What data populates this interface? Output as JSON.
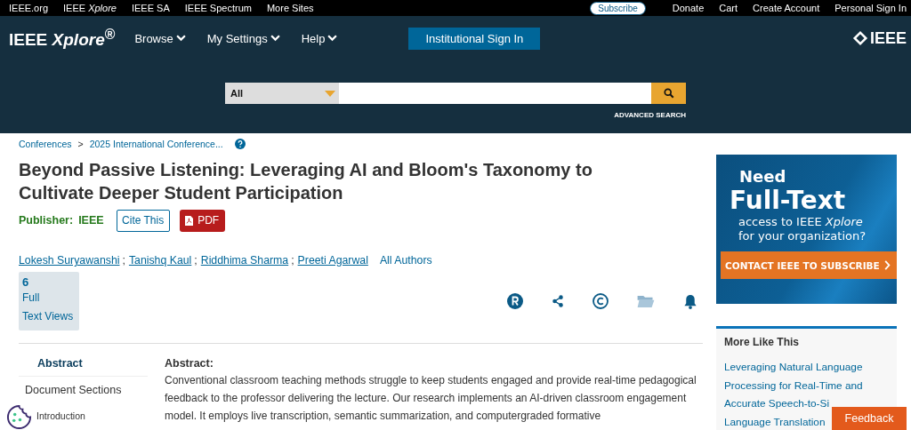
{
  "top_bar": {
    "links": [
      "IEEE.org",
      "IEEE *Xplore*",
      "IEEE SA",
      "IEEE Spectrum",
      "More Sites"
    ],
    "subscribe": "Subscribe",
    "right_links": [
      "Donate",
      "Cart",
      "Create Account",
      "Personal Sign In"
    ]
  },
  "header": {
    "logo": "IEEE *Xplore*$^{®}$",
    "menus": [
      "Browse",
      "My Settings",
      "Help"
    ],
    "sign_in": "Institutional Sign In",
    "brand": "IEEE"
  },
  "search": {
    "scope": "All",
    "advanced": "ADVANCED SEARCH"
  },
  "breadcrumb": {
    "items": [
      "Conferences",
      "2025 International Conference..."
    ],
    "separator": ">"
  },
  "article": {
    "title": "Beyond Passive Listening: Leveraging AI and Bloom's Taxonomy to Cultivate Deeper Student Participation",
    "publisher_label": "Publisher:",
    "publisher": "IEEE",
    "cite": "Cite This",
    "pdf": "PDF",
    "authors": [
      "Lokesh Suryawanshi",
      "Tanishq Kaul",
      "Riddhima Sharma",
      "Preeti Agarwal"
    ],
    "author_separator": ";",
    "all_authors": "All Authors",
    "views": {
      "count": "6",
      "label_1": "Full",
      "label_2": "Text Views"
    }
  },
  "nav": {
    "items": [
      {
        "label": "Abstract",
        "selected": true
      }
    ],
    "sections_heading": "Document Sections",
    "sections": [
      "Introduction"
    ]
  },
  "abstract": {
    "heading": "Abstract:",
    "text": "Conventional classroom teaching methods struggle to keep students engaged and provide real-time pedagogical feedback to the professor delivering the lecture. Our research implements an AI-driven classroom engagement model. It employs live transcription, semantic summarization, and computergraded formative"
  },
  "ad": {
    "line_1": "Need",
    "line_2": "Full-Text",
    "line_3": "access to IEEE *Xplore*",
    "line_4": "for your organization?",
    "cta": "CONTACT IEEE TO SUBSCRIBE"
  },
  "more_like_this": {
    "title": "More Like This",
    "lines": [
      "Leveraging Natural Language",
      "Processing for Real-Time and",
      "Accurate Speech-to-Si",
      "Language Translation"
    ]
  },
  "feedback": "Feedback"
}
